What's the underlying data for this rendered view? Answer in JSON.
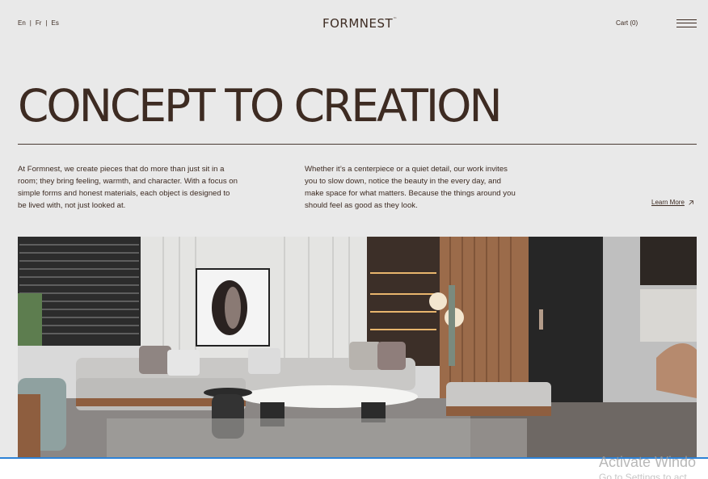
{
  "header": {
    "languages": [
      "En",
      "Fr",
      "Es"
    ],
    "separator": "|",
    "logo": "FORMNEST",
    "logo_mark": "™",
    "cart_label": "Cart (0)"
  },
  "hero_text": {
    "headline": "CONCEPT TO CREATION",
    "paragraph_left": "At Formnest, we create pieces that do more than just sit in a room; they bring feeling, warmth, and character. With a focus on simple forms and honest materials, each object is designed to be lived with, not just looked at.",
    "paragraph_right": "Whether it’s a centerpiece or a quiet detail, our work invites you to slow down, notice the beauty in the every day, and make space for what matters. Because the things around you should feel as good as they look.",
    "learn_more": "Learn More"
  },
  "overlay": {
    "watermark_line1": "Activate Windo",
    "watermark_line2": "Go to Settings to act"
  },
  "icons": {
    "menu": "hamburger-icon",
    "learn_more": "arrow-up-right-icon"
  },
  "colors": {
    "background": "#e9e9e9",
    "text": "#3d2b22",
    "taskbar_accent": "#2e82d6"
  }
}
